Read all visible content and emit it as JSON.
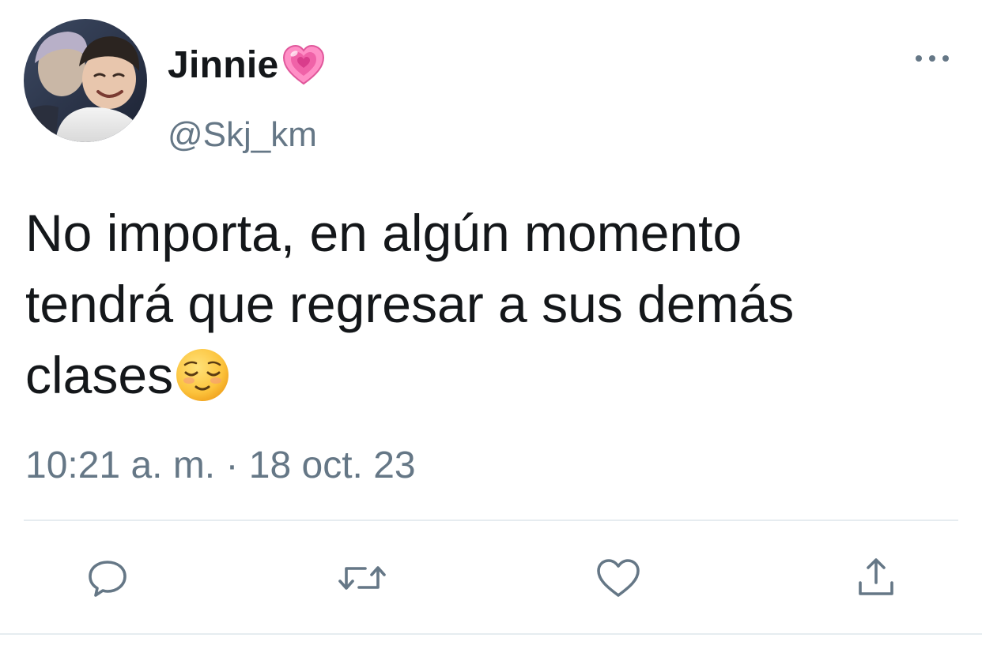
{
  "tweet": {
    "author": {
      "display_name": "Jinnie",
      "name_emoji": "growing-heart-emoji",
      "handle": "@Skj_km",
      "avatar": "profile-photo"
    },
    "text_lines": [
      "No importa, en algún momento",
      "tendrá que regresar a sus demás",
      "clases"
    ],
    "text_emoji": "relieved-face-emoji",
    "timestamp": "10:21 a. m. · 18 oct. 23"
  },
  "actions": [
    {
      "name": "reply",
      "icon": "reply-icon"
    },
    {
      "name": "retweet",
      "icon": "retweet-icon"
    },
    {
      "name": "like",
      "icon": "heart-icon"
    },
    {
      "name": "share",
      "icon": "share-icon"
    }
  ],
  "colors": {
    "text": "#14171a",
    "secondary": "#657786",
    "divider": "#e6ecf0",
    "heart_pink": "#f062a8"
  }
}
